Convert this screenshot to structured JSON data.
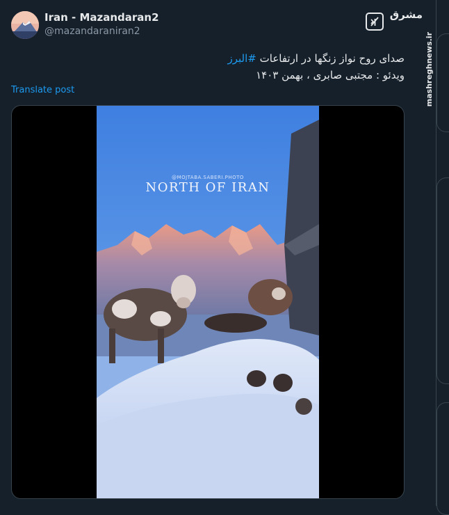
{
  "author": {
    "name": "Iran - Mazandaran2",
    "handle": "@mazandaraniran2"
  },
  "post": {
    "line1_prefix": "صدای روح نواز زنگها در ارتفاعات ",
    "hashtag": "#البرز",
    "line2": "ویدئو : مجتبی صابری ، بهمن ۱۴۰۳",
    "translate_label": "Translate post"
  },
  "media": {
    "watermark": "@MOJTABA.SABERI.PHOTO",
    "title": "NORTH OF IRAN"
  },
  "site": {
    "logo_text": "مشرق",
    "vertical_text": "mashreghnews.ir"
  },
  "icons": {
    "grok": "grok-icon"
  },
  "colors": {
    "background": "#15202b",
    "link": "#1d9bf0"
  }
}
